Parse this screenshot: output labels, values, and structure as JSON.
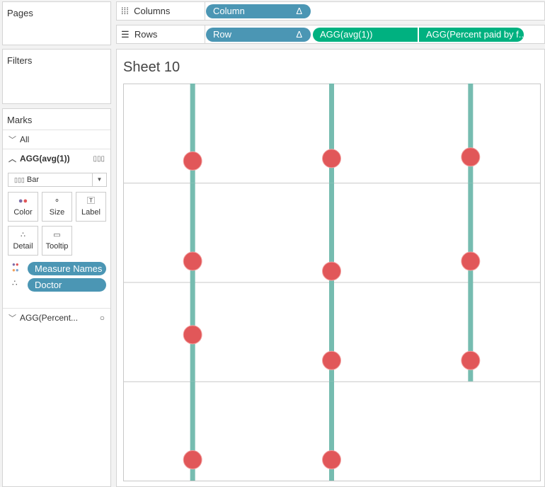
{
  "pages": {
    "title": "Pages"
  },
  "filters": {
    "title": "Filters"
  },
  "marks": {
    "title": "Marks",
    "all": "All",
    "card1": "AGG(avg(1))",
    "mark_type": "Bar",
    "buttons": [
      "Color",
      "Size",
      "Label",
      "Detail",
      "Tooltip"
    ],
    "pills": [
      "Measure Names",
      "Doctor"
    ],
    "card2": "AGG(Percent..."
  },
  "shelves": {
    "columns_label": "Columns",
    "columns": [
      "Column"
    ],
    "rows_label": "Rows",
    "rows": [
      "Row",
      "AGG(avg(1))",
      "AGG(Percent paid by f.."
    ],
    "delta": "Δ"
  },
  "sheet": {
    "title": "Sheet 10"
  },
  "colors": {
    "bar": "#76bcb0",
    "dot": "#e15759",
    "pill": "#4b96b4",
    "measure_pill": "#00b180"
  },
  "chart_data": {
    "type": "bar",
    "grid": {
      "rows": 4,
      "columns": 3
    },
    "cells": [
      {
        "row": 1,
        "column": 1,
        "dot": 0.22
      },
      {
        "row": 1,
        "column": 2,
        "dot": 0.245
      },
      {
        "row": 1,
        "column": 3,
        "dot": 0.26
      },
      {
        "row": 2,
        "column": 1,
        "dot": 0.21
      },
      {
        "row": 2,
        "column": 2,
        "dot": 0.11
      },
      {
        "row": 2,
        "column": 3,
        "dot": 0.21
      },
      {
        "row": 3,
        "column": 1,
        "dot": 0.47
      },
      {
        "row": 3,
        "column": 2,
        "dot": 0.21
      },
      {
        "row": 3,
        "column": 3,
        "dot": 0.21
      },
      {
        "row": 4,
        "column": 1,
        "dot": 0.21
      },
      {
        "row": 4,
        "column": 2,
        "dot": 0.21
      }
    ]
  }
}
